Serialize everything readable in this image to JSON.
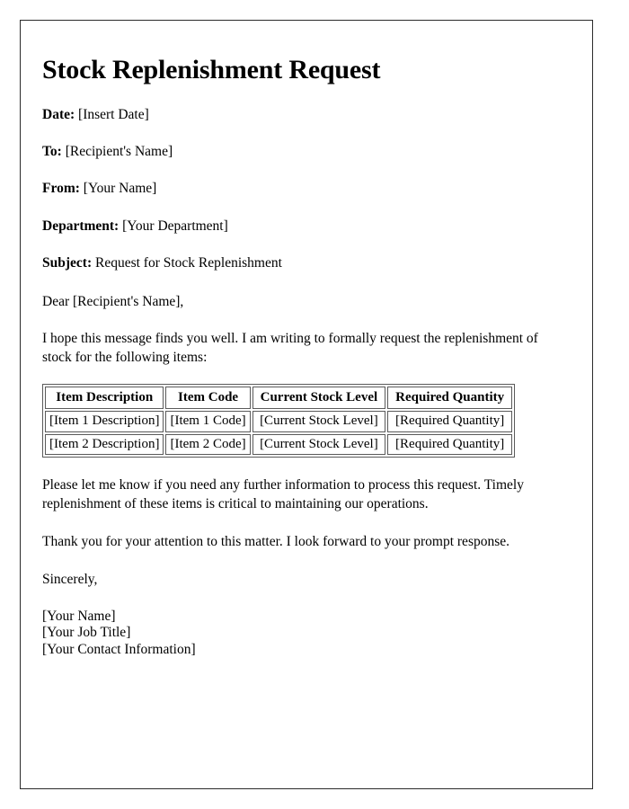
{
  "document": {
    "title": "Stock Replenishment Request",
    "fields": [
      {
        "label": "Date:",
        "value": "[Insert Date]"
      },
      {
        "label": "To:",
        "value": "[Recipient's Name]"
      },
      {
        "label": "From:",
        "value": "[Your Name]"
      },
      {
        "label": "Department:",
        "value": "[Your Department]"
      },
      {
        "label": "Subject:",
        "value": "Request for Stock Replenishment"
      }
    ],
    "salutation": "Dear [Recipient's Name],",
    "intro_paragraph": "I hope this message finds you well. I am writing to formally request the replenishment of stock for the following items:",
    "table": {
      "headers": [
        "Item Description",
        "Item Code",
        "Current Stock Level",
        "Required Quantity"
      ],
      "rows": [
        {
          "description": "[Item 1 Description]",
          "code": "[Item 1 Code]",
          "current_stock": "[Current Stock Level]",
          "required_quantity": "[Required Quantity]"
        },
        {
          "description": "[Item 2 Description]",
          "code": "[Item 2 Code]",
          "current_stock": "[Current Stock Level]",
          "required_quantity": "[Required Quantity]"
        }
      ]
    },
    "closing_paragraph_1": "Please let me know if you need any further information to process this request. Timely replenishment of these items is critical to maintaining our operations.",
    "closing_paragraph_2": "Thank you for your attention to this matter. I look forward to your prompt response.",
    "sign_off": "Sincerely,",
    "signature": [
      "[Your Name]",
      "[Your Job Title]",
      "[Your Contact Information]"
    ]
  }
}
